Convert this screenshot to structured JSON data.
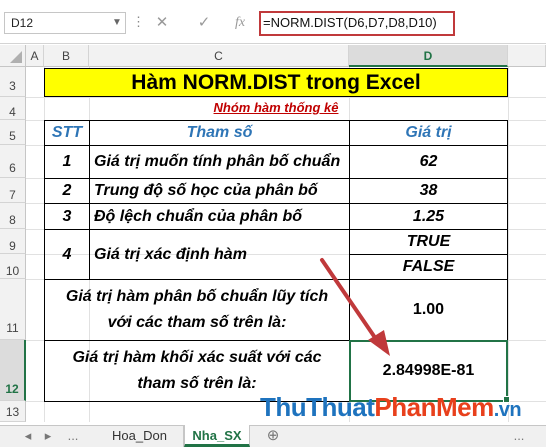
{
  "formula_bar": {
    "name_box": "D12",
    "dots": "⋮",
    "cancel": "✕",
    "enter": "✓",
    "fx": "fx",
    "formula": "=NORM.DIST(D6,D7,D8,D10)"
  },
  "columns": [
    "A",
    "B",
    "C",
    "D"
  ],
  "rows": [
    "3",
    "4",
    "5",
    "6",
    "7",
    "8",
    "9",
    "10",
    "11",
    "12",
    "13"
  ],
  "sheet": {
    "title": "Hàm NORM.DIST trong Excel",
    "subtitle": "Nhóm hàm thống kê",
    "headers": {
      "stt": "STT",
      "param": "Tham số",
      "value": "Giá trị"
    },
    "params": [
      {
        "stt": "1",
        "label": "Giá trị muốn tính phân bố chuẩn",
        "value": "62"
      },
      {
        "stt": "2",
        "label": "Trung độ số học của phân bố",
        "value": "38"
      },
      {
        "stt": "3",
        "label": "Độ lệch chuẩn của phân bố",
        "value": "1.25"
      },
      {
        "stt": "4",
        "label": "Giá trị xác định hàm",
        "value": "TRUE",
        "value2": "FALSE"
      }
    ],
    "result1": {
      "line1": "Giá trị hàm phân bố chuẩn lũy tích",
      "line2": "với các tham số trên là:",
      "value": "1.00"
    },
    "result2": {
      "line1": "Giá trị hàm khối xác suất với các",
      "line2": "tham số trên là:",
      "value": "2.84998E-81"
    }
  },
  "tabs": {
    "nav_prev": "◂",
    "nav_next": "▸",
    "more_left": "...",
    "sheet1": "Hoa_Don",
    "sheet2": "Nha_SX",
    "add": "⊕",
    "more_right": "..."
  },
  "watermark": {
    "part1": "Thu",
    "part2": "Thuat",
    "part3": "PhanMem",
    "part4": ".vn"
  },
  "colors": {
    "title_fill": "#ffff00",
    "accent_blue": "#2e75b6",
    "excel_green": "#217346",
    "arrow": "#c0393b"
  }
}
